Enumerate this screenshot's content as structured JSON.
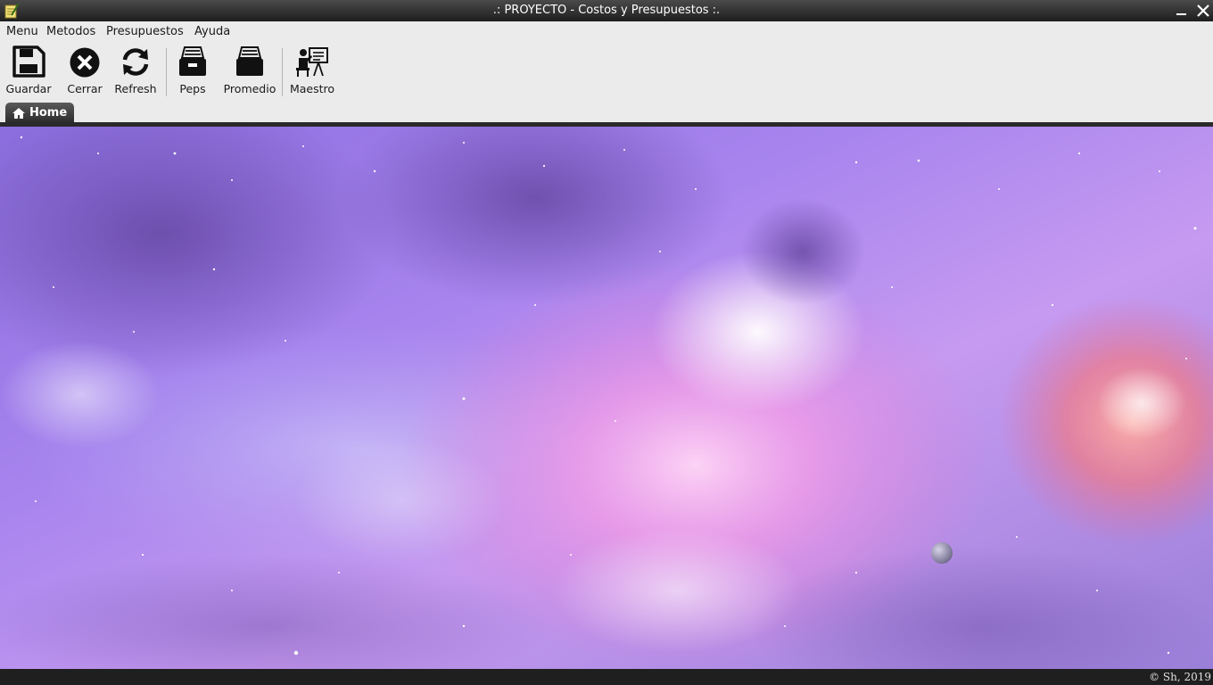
{
  "window": {
    "title": ".: PROYECTO - Costos y Presupuestos :.",
    "minimize_icon": "minimize-icon",
    "close_icon": "close-icon"
  },
  "menu": {
    "items": [
      {
        "label": "Menu"
      },
      {
        "label": "Metodos"
      },
      {
        "label": "Presupuestos"
      },
      {
        "label": "Ayuda"
      }
    ]
  },
  "toolbar": {
    "buttons": [
      {
        "label": "Guardar",
        "icon": "save-icon"
      },
      {
        "label": "Cerrar",
        "icon": "close-circle-icon"
      },
      {
        "label": "Refresh",
        "icon": "refresh-icon"
      },
      {
        "label": "Peps",
        "icon": "archive-tray-icon"
      },
      {
        "label": "Promedio",
        "icon": "inbox-tray-icon"
      },
      {
        "label": "Maestro",
        "icon": "teacher-board-icon"
      }
    ]
  },
  "tabs": [
    {
      "label": "Home",
      "icon": "home-icon",
      "active": true
    }
  ],
  "main": {
    "background": "galaxy-nebula-wallpaper"
  },
  "status": {
    "copyright": "© Sh, 2019"
  }
}
